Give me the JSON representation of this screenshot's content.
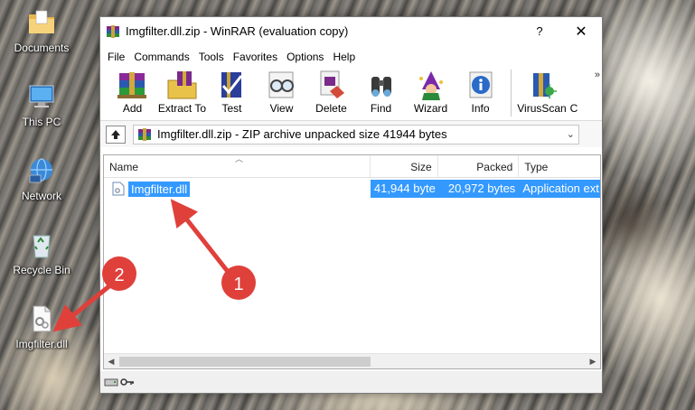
{
  "desktop": {
    "icons": [
      {
        "label": "Documents",
        "icon": "folder-documents-icon"
      },
      {
        "label": "This PC",
        "icon": "computer-icon"
      },
      {
        "label": "Network",
        "icon": "network-icon"
      },
      {
        "label": "Recycle Bin",
        "icon": "recycle-bin-icon"
      },
      {
        "label": "Imgfilter.dll",
        "icon": "dll-file-icon"
      }
    ]
  },
  "window": {
    "title": "Imgfilter.dll.zip - WinRAR (evaluation copy)",
    "help_glyph": "?",
    "close_glyph": "✕"
  },
  "menu": [
    "File",
    "Commands",
    "Tools",
    "Favorites",
    "Options",
    "Help"
  ],
  "toolbar": {
    "buttons": [
      {
        "label": "Add",
        "icon": "add-icon"
      },
      {
        "label": "Extract To",
        "icon": "extract-to-icon"
      },
      {
        "label": "Test",
        "icon": "test-icon"
      },
      {
        "label": "View",
        "icon": "view-icon"
      },
      {
        "label": "Delete",
        "icon": "delete-icon"
      },
      {
        "label": "Find",
        "icon": "find-icon"
      },
      {
        "label": "Wizard",
        "icon": "wizard-icon"
      },
      {
        "label": "Info",
        "icon": "info-icon"
      },
      {
        "label": "VirusScan",
        "icon": "virusscan-icon"
      },
      {
        "label": "C",
        "icon": "comment-icon"
      }
    ],
    "more_glyph": "»"
  },
  "address": {
    "path": "Imgfilter.dll.zip - ZIP archive unpacked size 41944 bytes",
    "dropdown_glyph": "⌄"
  },
  "file_list": {
    "columns": [
      "Name",
      "Size",
      "Packed",
      "Type"
    ],
    "rows": [
      {
        "name": "Imgfilter.dll",
        "size": "41,944 byte",
        "packed": "20,972 bytes",
        "type": "Application ext"
      }
    ],
    "selected_color": "#3399ff"
  },
  "annotations": {
    "badge_1": "1",
    "badge_2": "2",
    "color": "#e0403a"
  }
}
